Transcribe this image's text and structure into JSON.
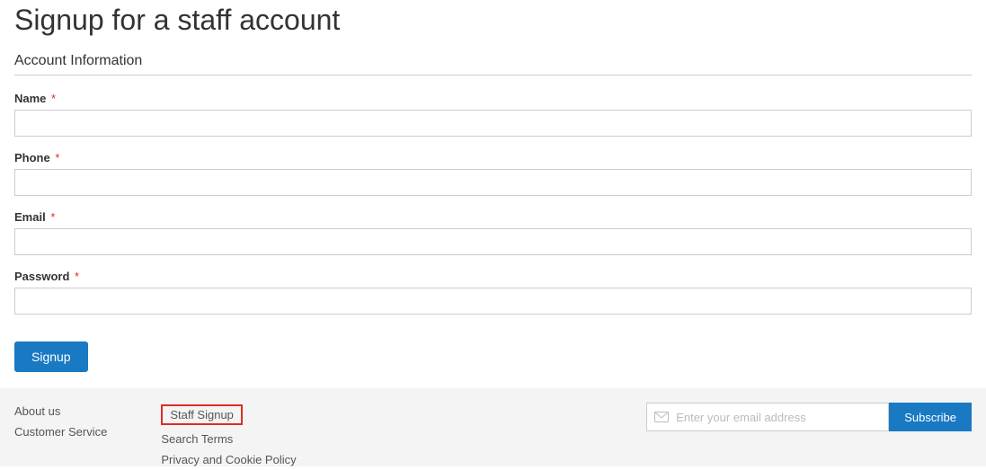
{
  "page": {
    "title": "Signup for a staff account",
    "section_title": "Account Information"
  },
  "form": {
    "name": {
      "label": "Name",
      "value": ""
    },
    "phone": {
      "label": "Phone",
      "value": ""
    },
    "email": {
      "label": "Email",
      "value": ""
    },
    "password": {
      "label": "Password",
      "value": ""
    },
    "required_mark": "*",
    "submit_label": "Signup"
  },
  "footer": {
    "col1": {
      "about": "About us",
      "customer_service": "Customer Service"
    },
    "col2": {
      "staff_signup": "Staff Signup",
      "search_terms": "Search Terms",
      "privacy": "Privacy and Cookie Policy"
    },
    "newsletter": {
      "placeholder": "Enter your email address",
      "value": "",
      "subscribe_label": "Subscribe"
    }
  }
}
